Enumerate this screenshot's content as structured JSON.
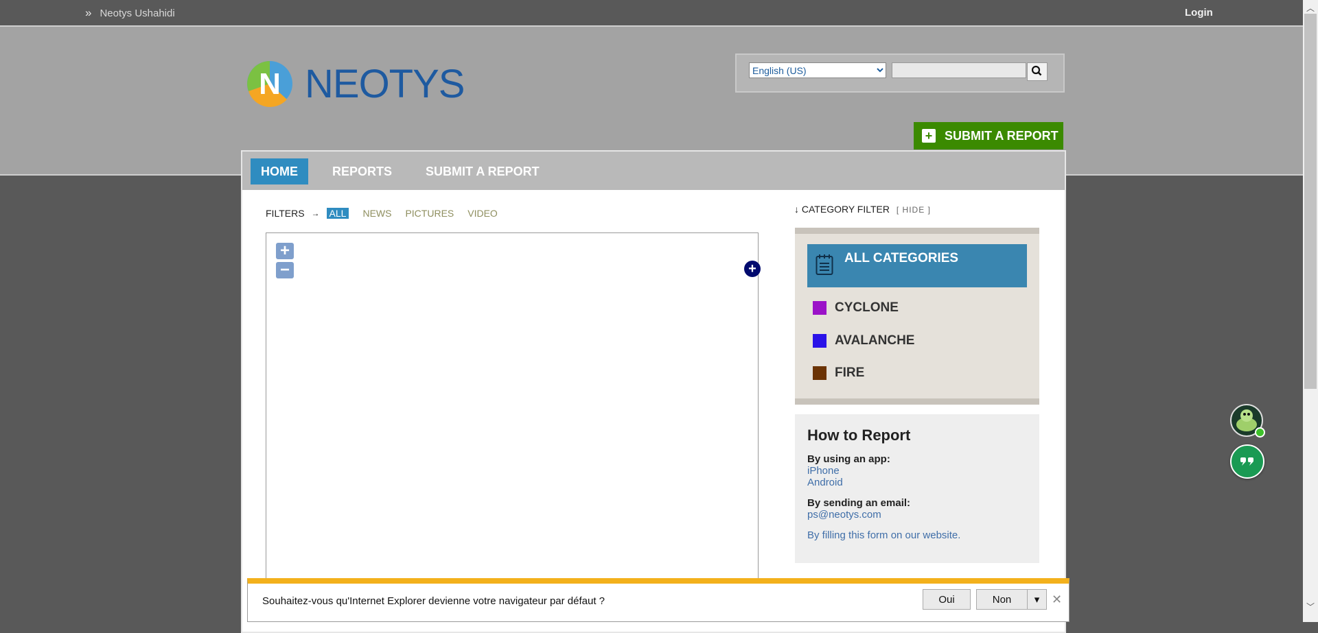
{
  "topbar": {
    "site_name": "Neotys Ushahidi",
    "chevron": "»",
    "login": "Login"
  },
  "header": {
    "logo_text": "NEOTYS",
    "language": {
      "selected": "English (US)"
    },
    "search": {
      "value": ""
    },
    "submit_button": "SUBMIT A REPORT"
  },
  "nav": {
    "tabs": [
      {
        "label": "HOME"
      },
      {
        "label": "REPORTS"
      },
      {
        "label": "SUBMIT A REPORT"
      }
    ]
  },
  "filters": {
    "label": "FILTERS",
    "arrow": "→",
    "items": [
      {
        "label": "ALL"
      },
      {
        "label": "NEWS"
      },
      {
        "label": "PICTURES"
      },
      {
        "label": "VIDEO"
      }
    ]
  },
  "map": {
    "zoom_in": "+",
    "zoom_out": "−",
    "layer_switcher": "+"
  },
  "category_filter": {
    "arrow": "↓",
    "title": "CATEGORY FILTER",
    "hide": "[ HIDE ]",
    "all": "ALL CATEGORIES",
    "items": [
      {
        "label": "CYCLONE",
        "color": "#9b12c8"
      },
      {
        "label": "AVALANCHE",
        "color": "#2a12e8"
      },
      {
        "label": "FIRE",
        "color": "#6b3305"
      }
    ]
  },
  "how_to": {
    "title": "How to Report",
    "app_label": "By using an app:",
    "apps": [
      "iPhone",
      "Android"
    ],
    "email_label": "By sending an email:",
    "email": "ps@neotys.com",
    "form_link": "By filling this form on our website."
  },
  "chat": {
    "icon": "quote-icon"
  },
  "ie_bar": {
    "message": "Souhaitez-vous qu'Internet Explorer devienne votre navigateur par défaut ?",
    "yes": "Oui",
    "no": "Non",
    "dropdown": "▾",
    "close": "✕"
  },
  "colors": {
    "accent": "#2f8cc0",
    "submit": "#3b8a00",
    "ie_warning": "#f3b11c"
  }
}
